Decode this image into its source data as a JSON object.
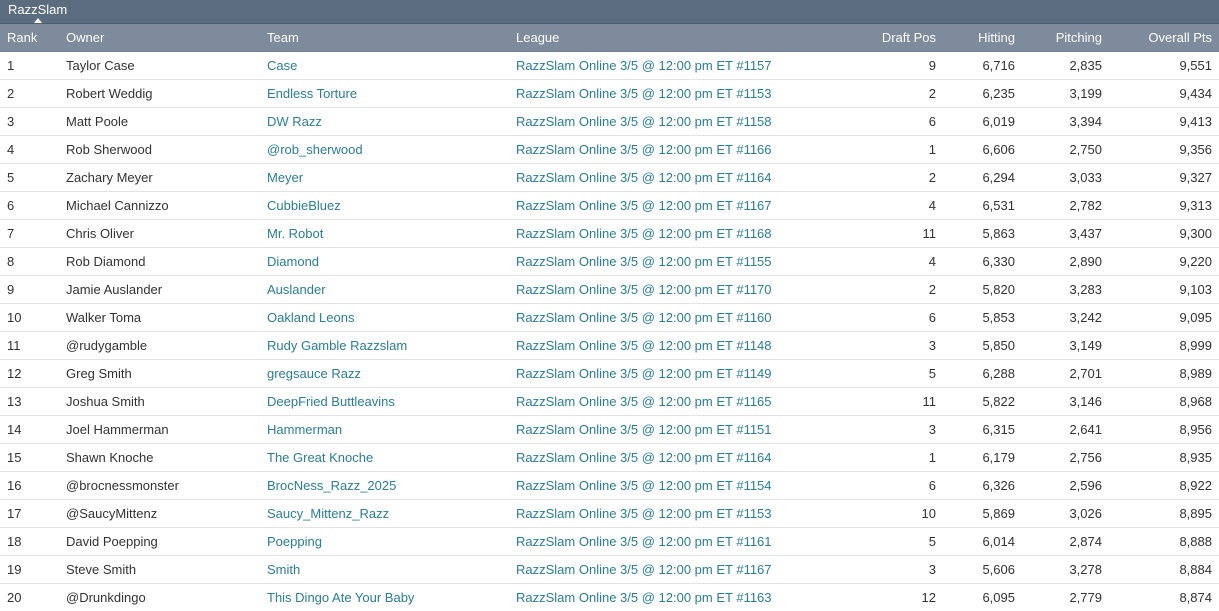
{
  "tab": {
    "label": "RazzSlam"
  },
  "columns": {
    "rank": "Rank",
    "owner": "Owner",
    "team": "Team",
    "league": "League",
    "draft_pos": "Draft Pos",
    "hitting": "Hitting",
    "pitching": "Pitching",
    "overall": "Overall Pts"
  },
  "rows": [
    {
      "rank": "1",
      "owner": "Taylor Case",
      "team": "Case",
      "league": "RazzSlam Online 3/5 @ 12:00 pm ET #1157",
      "draft_pos": "9",
      "hitting": "6,716",
      "pitching": "2,835",
      "overall": "9,551"
    },
    {
      "rank": "2",
      "owner": "Robert Weddig",
      "team": "Endless Torture",
      "league": "RazzSlam Online 3/5 @ 12:00 pm ET #1153",
      "draft_pos": "2",
      "hitting": "6,235",
      "pitching": "3,199",
      "overall": "9,434"
    },
    {
      "rank": "3",
      "owner": "Matt Poole",
      "team": "DW Razz",
      "league": "RazzSlam Online 3/5 @ 12:00 pm ET #1158",
      "draft_pos": "6",
      "hitting": "6,019",
      "pitching": "3,394",
      "overall": "9,413"
    },
    {
      "rank": "4",
      "owner": "Rob Sherwood",
      "team": "@rob_sherwood",
      "league": "RazzSlam Online 3/5 @ 12:00 pm ET #1166",
      "draft_pos": "1",
      "hitting": "6,606",
      "pitching": "2,750",
      "overall": "9,356"
    },
    {
      "rank": "5",
      "owner": "Zachary Meyer",
      "team": "Meyer",
      "league": "RazzSlam Online 3/5 @ 12:00 pm ET #1164",
      "draft_pos": "2",
      "hitting": "6,294",
      "pitching": "3,033",
      "overall": "9,327"
    },
    {
      "rank": "6",
      "owner": "Michael Cannizzo",
      "team": "CubbieBluez",
      "league": "RazzSlam Online 3/5 @ 12:00 pm ET #1167",
      "draft_pos": "4",
      "hitting": "6,531",
      "pitching": "2,782",
      "overall": "9,313"
    },
    {
      "rank": "7",
      "owner": "Chris Oliver",
      "team": "Mr. Robot",
      "league": "RazzSlam Online 3/5 @ 12:00 pm ET #1168",
      "draft_pos": "11",
      "hitting": "5,863",
      "pitching": "3,437",
      "overall": "9,300"
    },
    {
      "rank": "8",
      "owner": "Rob Diamond",
      "team": "Diamond",
      "league": "RazzSlam Online 3/5 @ 12:00 pm ET #1155",
      "draft_pos": "4",
      "hitting": "6,330",
      "pitching": "2,890",
      "overall": "9,220"
    },
    {
      "rank": "9",
      "owner": "Jamie Auslander",
      "team": "Auslander",
      "league": "RazzSlam Online 3/5 @ 12:00 pm ET #1170",
      "draft_pos": "2",
      "hitting": "5,820",
      "pitching": "3,283",
      "overall": "9,103"
    },
    {
      "rank": "10",
      "owner": "Walker Toma",
      "team": "Oakland Leons",
      "league": "RazzSlam Online 3/5 @ 12:00 pm ET #1160",
      "draft_pos": "6",
      "hitting": "5,853",
      "pitching": "3,242",
      "overall": "9,095"
    },
    {
      "rank": "11",
      "owner": "@rudygamble",
      "team": "Rudy Gamble Razzslam",
      "league": "RazzSlam Online 3/5 @ 12:00 pm ET #1148",
      "draft_pos": "3",
      "hitting": "5,850",
      "pitching": "3,149",
      "overall": "8,999"
    },
    {
      "rank": "12",
      "owner": "Greg Smith",
      "team": "gregsauce Razz",
      "league": "RazzSlam Online 3/5 @ 12:00 pm ET #1149",
      "draft_pos": "5",
      "hitting": "6,288",
      "pitching": "2,701",
      "overall": "8,989"
    },
    {
      "rank": "13",
      "owner": "Joshua Smith",
      "team": "DeepFried Buttleavins",
      "league": "RazzSlam Online 3/5 @ 12:00 pm ET #1165",
      "draft_pos": "11",
      "hitting": "5,822",
      "pitching": "3,146",
      "overall": "8,968"
    },
    {
      "rank": "14",
      "owner": "Joel Hammerman",
      "team": "Hammerman",
      "league": "RazzSlam Online 3/5 @ 12:00 pm ET #1151",
      "draft_pos": "3",
      "hitting": "6,315",
      "pitching": "2,641",
      "overall": "8,956"
    },
    {
      "rank": "15",
      "owner": "Shawn Knoche",
      "team": "The Great Knoche",
      "league": "RazzSlam Online 3/5 @ 12:00 pm ET #1164",
      "draft_pos": "1",
      "hitting": "6,179",
      "pitching": "2,756",
      "overall": "8,935"
    },
    {
      "rank": "16",
      "owner": "@brocnessmonster",
      "team": "BrocNess_Razz_2025",
      "league": "RazzSlam Online 3/5 @ 12:00 pm ET #1154",
      "draft_pos": "6",
      "hitting": "6,326",
      "pitching": "2,596",
      "overall": "8,922"
    },
    {
      "rank": "17",
      "owner": "@SaucyMittenz",
      "team": "Saucy_Mittenz_Razz",
      "league": "RazzSlam Online 3/5 @ 12:00 pm ET #1153",
      "draft_pos": "10",
      "hitting": "5,869",
      "pitching": "3,026",
      "overall": "8,895"
    },
    {
      "rank": "18",
      "owner": "David Poepping",
      "team": "Poepping",
      "league": "RazzSlam Online 3/5 @ 12:00 pm ET #1161",
      "draft_pos": "5",
      "hitting": "6,014",
      "pitching": "2,874",
      "overall": "8,888"
    },
    {
      "rank": "19",
      "owner": "Steve Smith",
      "team": "Smith",
      "league": "RazzSlam Online 3/5 @ 12:00 pm ET #1167",
      "draft_pos": "3",
      "hitting": "5,606",
      "pitching": "3,278",
      "overall": "8,884"
    },
    {
      "rank": "20",
      "owner": "@Drunkdingo",
      "team": "This Dingo Ate Your Baby",
      "league": "RazzSlam Online 3/5 @ 12:00 pm ET #1163",
      "draft_pos": "12",
      "hitting": "6,095",
      "pitching": "2,779",
      "overall": "8,874"
    }
  ]
}
